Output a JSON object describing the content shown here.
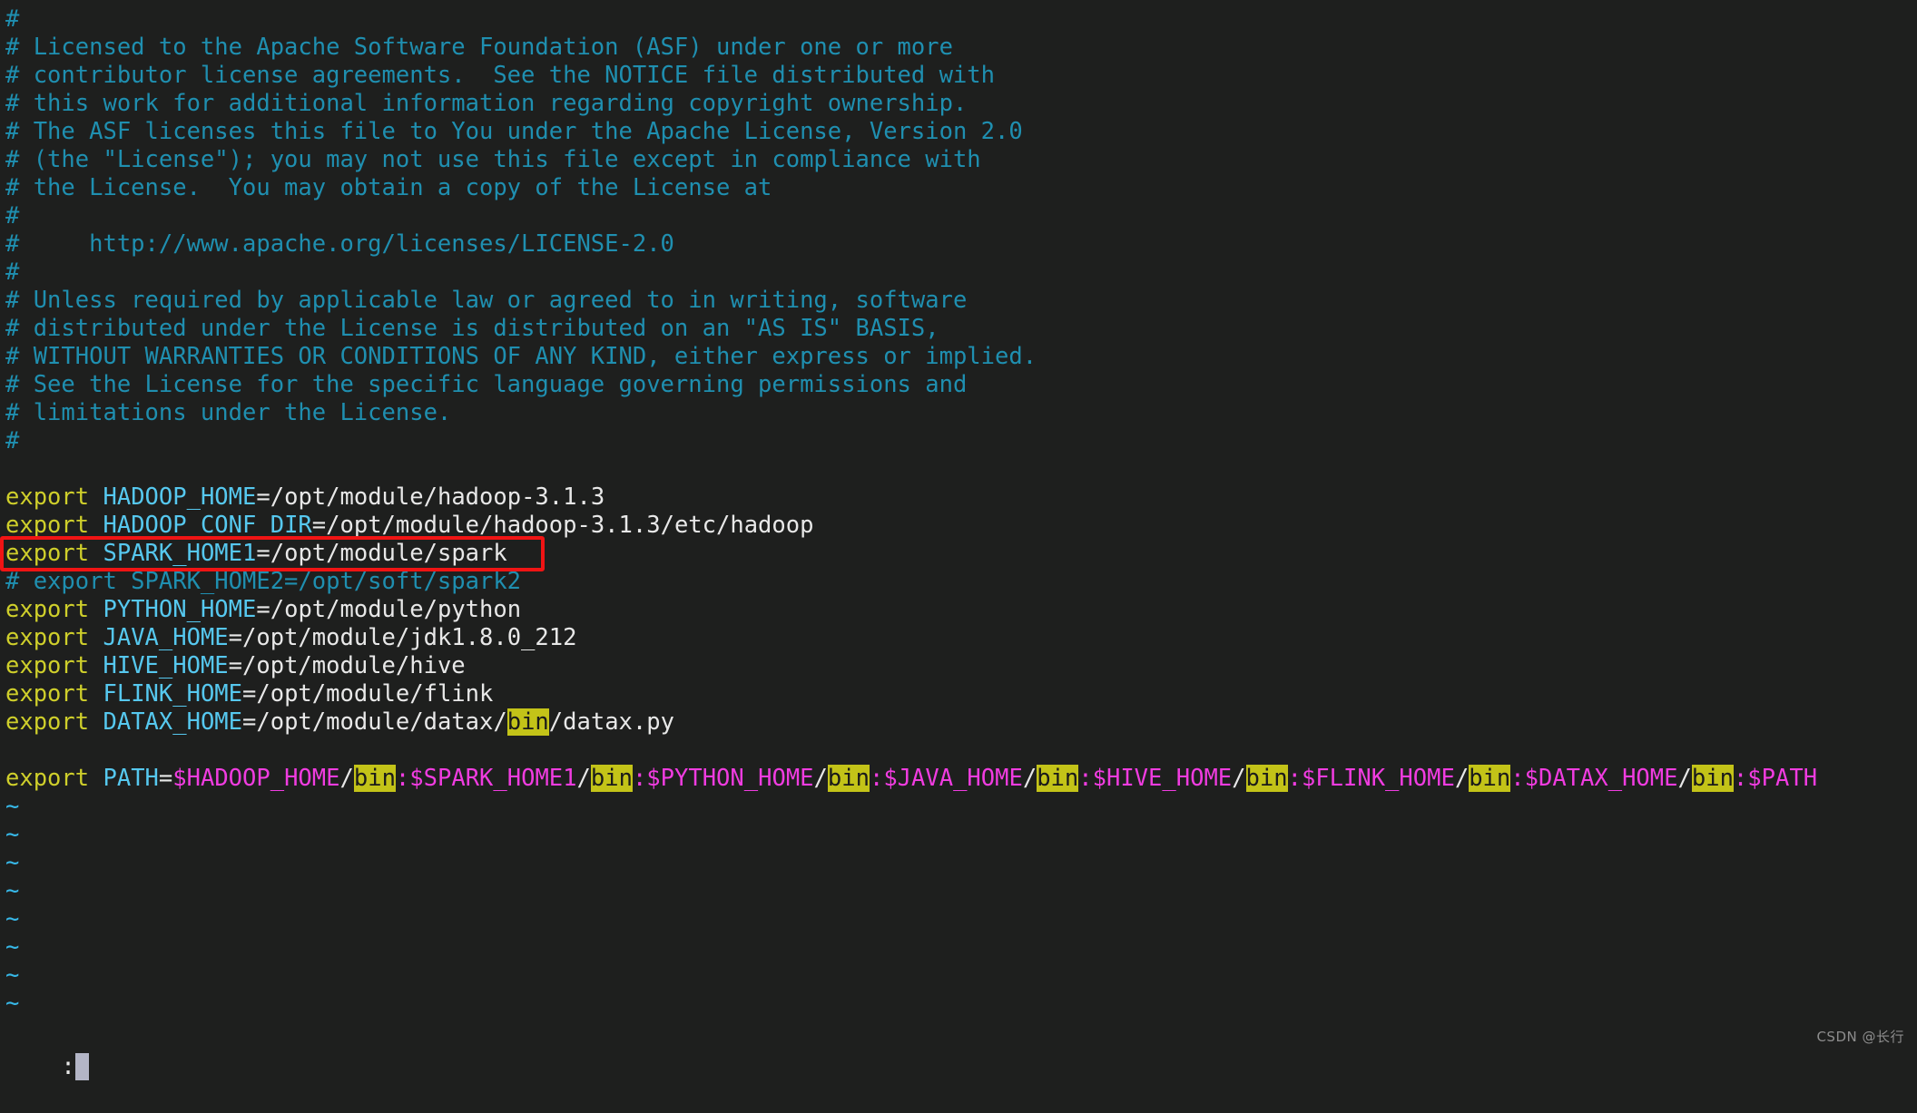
{
  "editor": {
    "app": "vim",
    "background_color": "#1e1f1e",
    "colors": {
      "comment": "#1f8fb0",
      "keyword": "#cfcf2b",
      "variable": "#56c8ef",
      "punctuation": "#e8e8e8",
      "path": "#e8e8e8",
      "dollar_var": "#f03ce0",
      "search_highlight_bg": "#c3c318",
      "search_highlight_fg": "#1a1a1a",
      "tilde": "#37b8e8",
      "annotation_red": "#f01414",
      "cursor": "#b3b5c6"
    },
    "lines": [
      {
        "type": "comment",
        "text": "#"
      },
      {
        "type": "comment",
        "text": "# Licensed to the Apache Software Foundation (ASF) under one or more"
      },
      {
        "type": "comment",
        "text": "# contributor license agreements.  See the NOTICE file distributed with"
      },
      {
        "type": "comment",
        "text": "# this work for additional information regarding copyright ownership."
      },
      {
        "type": "comment",
        "text": "# The ASF licenses this file to You under the Apache License, Version 2.0"
      },
      {
        "type": "comment",
        "text": "# (the \"License\"); you may not use this file except in compliance with"
      },
      {
        "type": "comment",
        "text": "# the License.  You may obtain a copy of the License at"
      },
      {
        "type": "comment",
        "text": "#"
      },
      {
        "type": "comment",
        "text": "#     http://www.apache.org/licenses/LICENSE-2.0"
      },
      {
        "type": "comment",
        "text": "#"
      },
      {
        "type": "comment",
        "text": "# Unless required by applicable law or agreed to in writing, software"
      },
      {
        "type": "comment",
        "text": "# distributed under the License is distributed on an \"AS IS\" BASIS,"
      },
      {
        "type": "comment",
        "text": "# WITHOUT WARRANTIES OR CONDITIONS OF ANY KIND, either express or implied."
      },
      {
        "type": "comment",
        "text": "# See the License for the specific language governing permissions and"
      },
      {
        "type": "comment",
        "text": "# limitations under the License."
      },
      {
        "type": "comment",
        "text": "#"
      },
      {
        "type": "blank",
        "text": ""
      },
      {
        "type": "export",
        "keyword": "export",
        "name": "HADOOP_HOME",
        "value": "/opt/module/hadoop-3.1.3"
      },
      {
        "type": "export",
        "keyword": "export",
        "name": "HADOOP_CONF_DIR",
        "value": "/opt/module/hadoop-3.1.3/etc/hadoop"
      },
      {
        "type": "export",
        "keyword": "export",
        "name": "SPARK_HOME1",
        "value": "/opt/module/spark",
        "boxed": true
      },
      {
        "type": "comment",
        "text": "# export SPARK_HOME2=/opt/soft/spark2"
      },
      {
        "type": "export",
        "keyword": "export",
        "name": "PYTHON_HOME",
        "value": "/opt/module/python"
      },
      {
        "type": "export",
        "keyword": "export",
        "name": "JAVA_HOME",
        "value": "/opt/module/jdk1.8.0_212"
      },
      {
        "type": "export",
        "keyword": "export",
        "name": "HIVE_HOME",
        "value": "/opt/module/hive"
      },
      {
        "type": "export",
        "keyword": "export",
        "name": "FLINK_HOME",
        "value": "/opt/module/flink"
      },
      {
        "type": "export_hl",
        "keyword": "export",
        "name": "DATAX_HOME",
        "pre": "/opt/module/datax/",
        "hl": "bin",
        "post": "/datax.py"
      },
      {
        "type": "blank",
        "text": ""
      },
      {
        "type": "path",
        "keyword": "export",
        "name": "PATH",
        "segments": [
          {
            "dollar": "$HADOOP_HOME",
            "slash": "/",
            "hl": "bin",
            "colon": ":"
          },
          {
            "dollar": "$SPARK_HOME1",
            "slash": "/",
            "hl": "bin",
            "colon": ":"
          },
          {
            "dollar": "$PYTHON_HOME",
            "slash": "/",
            "hl": "bin",
            "colon": ":"
          },
          {
            "dollar": "$JAVA_HOME",
            "slash": "/",
            "hl": "bin",
            "colon": ":"
          },
          {
            "dollar": "$HIVE_HOME",
            "slash": "/",
            "hl": "bin",
            "colon": ":"
          },
          {
            "dollar": "$FLINK_HOME",
            "slash": "/",
            "hl": "bin",
            "colon": ":"
          },
          {
            "dollar": "$DATAX_HOME",
            "slash": "/",
            "hl": "bin",
            "colon": ":"
          }
        ],
        "tail": "$PATH"
      },
      {
        "type": "tilde",
        "text": "~"
      },
      {
        "type": "tilde",
        "text": "~"
      },
      {
        "type": "tilde",
        "text": "~"
      },
      {
        "type": "tilde",
        "text": "~"
      },
      {
        "type": "tilde",
        "text": "~"
      },
      {
        "type": "tilde",
        "text": "~"
      },
      {
        "type": "tilde",
        "text": "~"
      },
      {
        "type": "tilde",
        "text": "~"
      }
    ],
    "status_line": {
      "prompt": ":",
      "cursor": true
    },
    "annotation": {
      "type": "red-rectangle",
      "target_line_index": 19,
      "target_text": "export SPARK_HOME1=/opt/module/spark"
    }
  },
  "watermark": {
    "text": "CSDN @长行"
  }
}
